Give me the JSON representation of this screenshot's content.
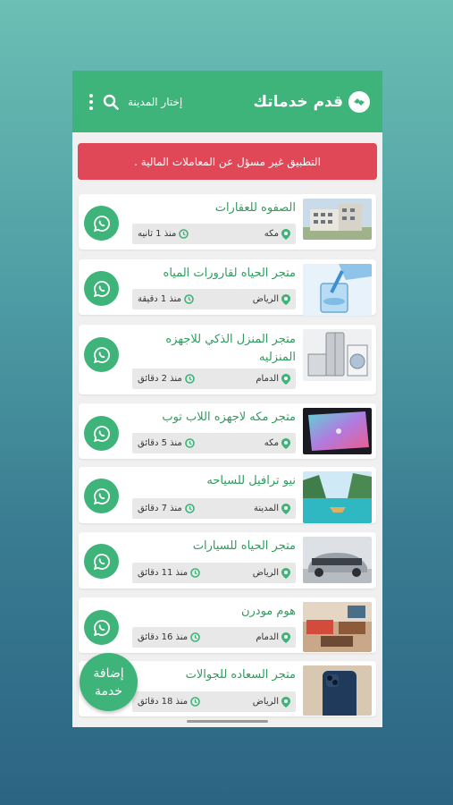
{
  "app": {
    "title": "قدم خدماتك",
    "city_select_label": "إختار المدينة",
    "disclaimer": "التطبيق غير مسؤل عن المعاملات المالية ."
  },
  "colors": {
    "brand": "#3eb37a",
    "banner": "#e04757",
    "title_text": "#2f9c5e"
  },
  "icons": {
    "search": "search-icon",
    "menu": "kebab-menu-icon",
    "location": "map-pin-icon",
    "time": "clock-icon",
    "whatsapp": "whatsapp-icon"
  },
  "listings": [
    {
      "title": "الصفوه للعقارات",
      "city": "مكه",
      "time": "منذ 1 ثانيه"
    },
    {
      "title": "متجر الحياه لقارورات المياه",
      "city": "الرياض",
      "time": "منذ 1 دقيقة"
    },
    {
      "title": "متجر المنزل الذكي للاجهزه المنزليه",
      "city": "الدمام",
      "time": "منذ 2 دقائق"
    },
    {
      "title": "متجر مكه لاجهزه اللاب توب",
      "city": "مكه",
      "time": "منذ 5 دقائق"
    },
    {
      "title": "نيو ترافيل للسياحه",
      "city": "المدينة",
      "time": "منذ 7 دقائق"
    },
    {
      "title": "متجر الحياه للسيارات",
      "city": "الرياض",
      "time": "منذ 11 دقائق"
    },
    {
      "title": "هوم مودرن",
      "city": "الدمام",
      "time": "منذ 16 دقائق"
    },
    {
      "title": "متجر السعاده للجوالات",
      "city": "الرياض",
      "time": "منذ 18 دقائق"
    }
  ],
  "fab": {
    "line1": "إضافة",
    "line2": "خدمة"
  }
}
